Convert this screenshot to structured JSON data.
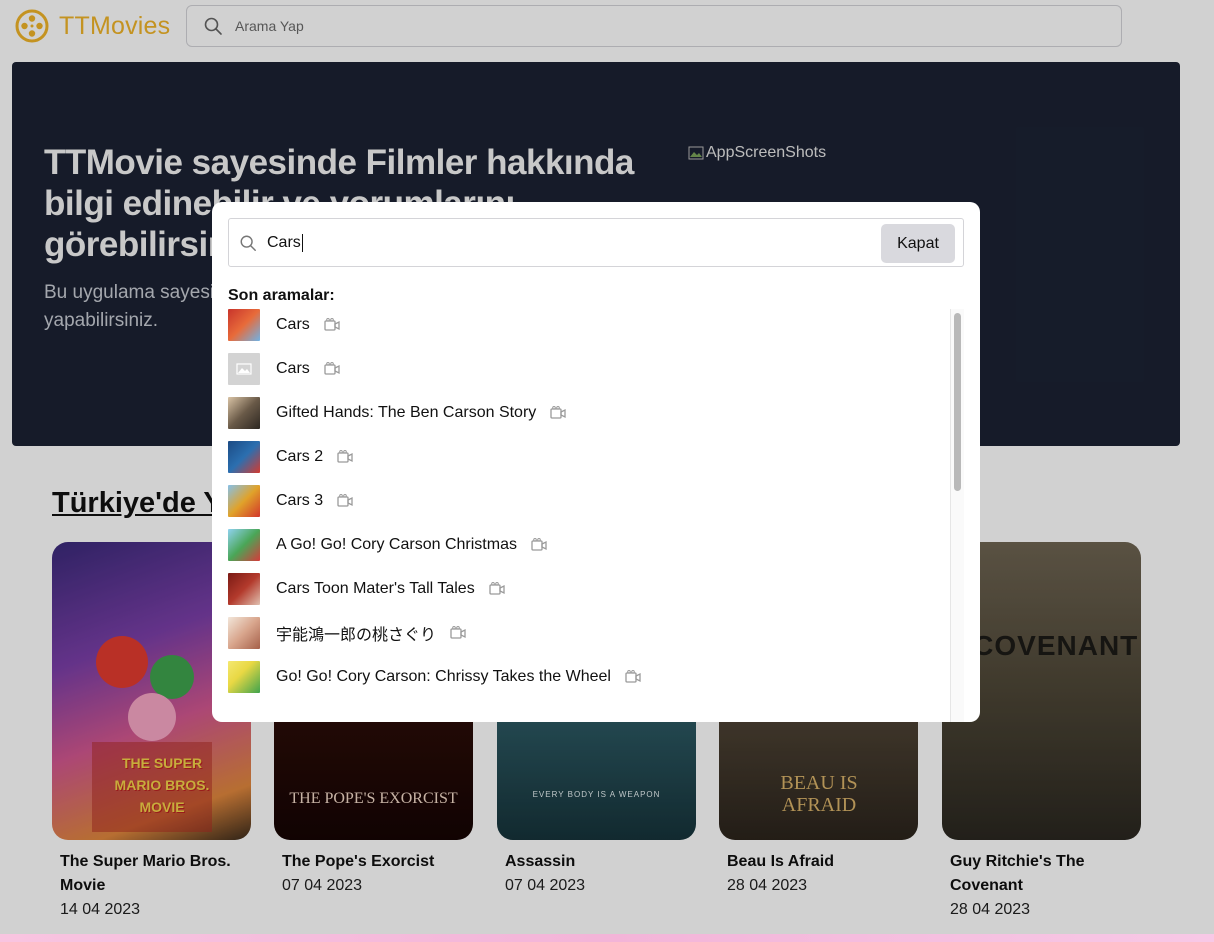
{
  "header": {
    "logo_text": "TTMovies",
    "search_placeholder": "Arama Yap"
  },
  "hero": {
    "title": "TTMovie sayesinde Filmler hakkında bilgi edinebilir ve yorumlarını görebilirsiniz.",
    "subtitle": "Bu uygulama sayesinde filmler hakkında bilgi edinebilir ve arama yapabilirsiniz.",
    "image_alt": "AppScreenShots"
  },
  "section": {
    "title": "Türkiye'de Yakında"
  },
  "movies": [
    {
      "title": "The Super Mario Bros. Movie",
      "date": "14 04 2023",
      "poster_text": "THE SUPER MARIO BROS. MOVIE"
    },
    {
      "title": "The Pope's Exorcist",
      "date": "07 04 2023",
      "poster_text": "THE POPE'S EXORCIST"
    },
    {
      "title": "Assassin",
      "date": "07 04 2023",
      "poster_text": "EVERY BODY IS A WEAPON"
    },
    {
      "title": "Beau Is Afraid",
      "date": "28 04 2023",
      "poster_text": "BEAU IS AFRAID"
    },
    {
      "title": "Guy Ritchie's The Covenant",
      "date": "28 04 2023",
      "poster_text": "E COVENANT"
    }
  ],
  "modal": {
    "query": "Cars",
    "close_label": "Kapat",
    "recent_label": "Son aramalar:",
    "results": [
      {
        "title": "Cars",
        "thumb": "#c8342b"
      },
      {
        "title": "Cars",
        "thumb": "#d3d3d3"
      },
      {
        "title": "Gifted Hands: The Ben Carson Story",
        "thumb": "#6a5a48"
      },
      {
        "title": "Cars 2",
        "thumb": "#2b6fb0"
      },
      {
        "title": "Cars 3",
        "thumb": "#e0a22a"
      },
      {
        "title": "A Go! Go! Cory Carson Christmas",
        "thumb": "#4aa657"
      },
      {
        "title": "Cars Toon Mater's Tall Tales",
        "thumb": "#b33a2c"
      },
      {
        "title": "宇能鴻一郎の桃さぐり",
        "thumb": "#d8a58c"
      },
      {
        "title": "Go! Go! Cory Carson: Chrissy Takes the Wheel",
        "thumb": "#e9d844"
      }
    ]
  },
  "colors": {
    "brand": "#f0b429",
    "hero_bg": "#1b2233"
  }
}
